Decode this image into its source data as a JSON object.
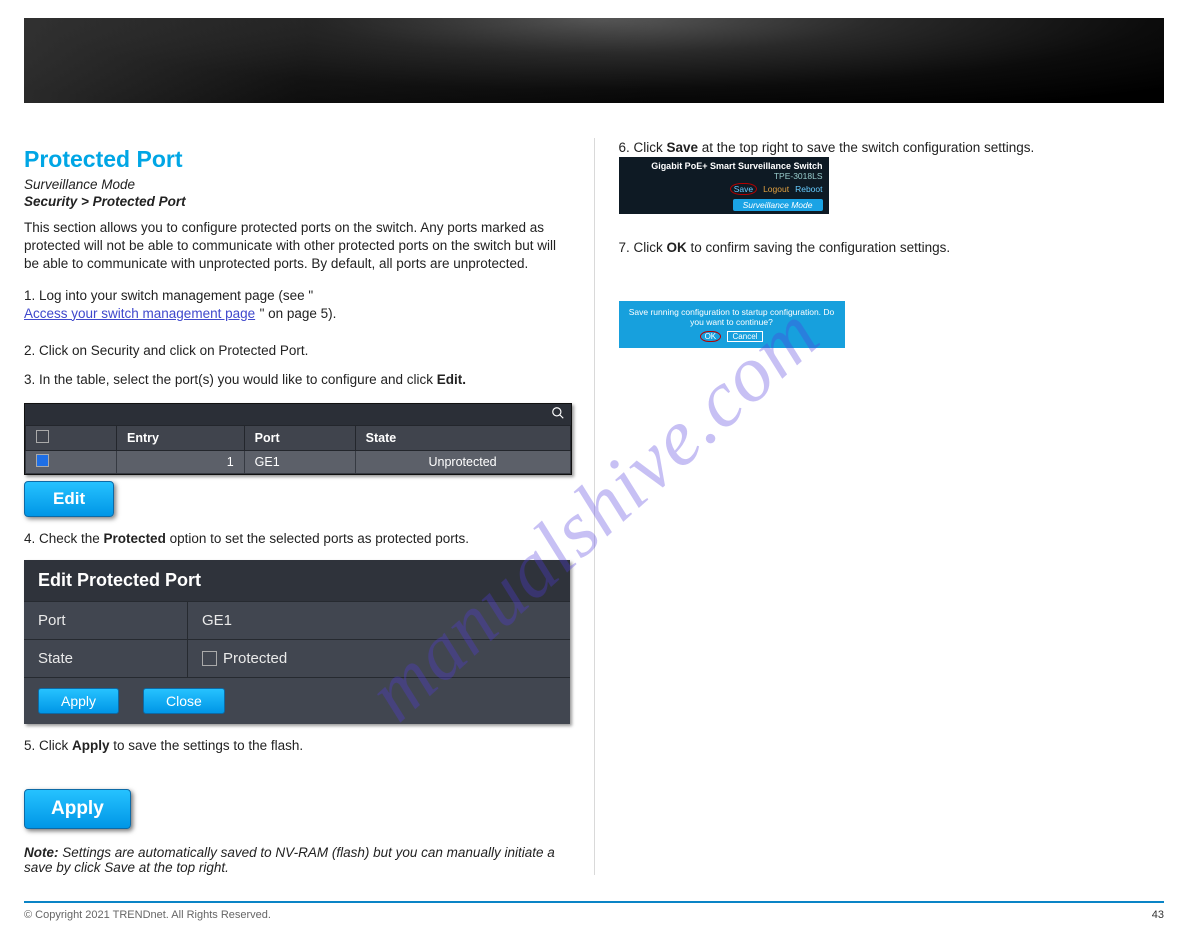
{
  "header": {
    "copyright": "",
    "guide": "",
    "model": ""
  },
  "left": {
    "title": "Protected Port",
    "sub": "Surveillance Mode",
    "path": "Security > Protected Port",
    "intro": "This section allows you to configure protected ports on the switch. Any ports marked as protected will not be able to communicate with other protected ports on the switch but will be able to communicate with unprotected ports. By default, all ports are unprotected.",
    "step1_prefix": "1. Log into your switch management page (see \"",
    "step1_link": "Access your switch management page",
    "step1_suffix": "\" on page 5).",
    "step2": "2. Click on Security and click on Protected Port.",
    "step3_a": "3. In the table, select the port(s) you would like to configure and click ",
    "step3_b": "Edit.",
    "table": {
      "cols": [
        "",
        "Entry",
        "Port",
        "State"
      ],
      "row": {
        "entry": "1",
        "port": "GE1",
        "state": "Unprotected"
      },
      "edit": "Edit"
    },
    "step4_a": "4. Check the ",
    "step4_b": "Protected",
    "step4_c": " option to set the selected ports as protected ports.",
    "panel": {
      "title": "Edit Protected Port",
      "port_label": "Port",
      "port_value": "GE1",
      "state_label": "State",
      "state_value": "Protected",
      "apply": "Apply",
      "close": "Close"
    },
    "step5_a": "5. Click ",
    "step5_b": "Apply",
    "step5_c": " to save the settings to the flash.",
    "apply_btn": "Apply",
    "note_a": "Note: ",
    "note_b": "Settings are automatically saved to NV-RAM (flash) but you can manually initiate a save by click Save at the top right."
  },
  "right": {
    "step6_a": "6. Click ",
    "step6_b": "Save",
    "step6_c": " at the top right to save the switch configuration settings.",
    "mini": {
      "t1": "Gigabit PoE+ Smart Surveillance Switch",
      "t2": "TPE-3018LS",
      "save": "Save",
      "logout": "Logout",
      "reboot": "Reboot",
      "mode": "Surveillance Mode"
    },
    "step7_a": "7. Click ",
    "step7_b": "OK",
    "step7_c": " to confirm saving the configuration settings.",
    "dialog": {
      "msg": "Save running configuration to startup configuration. Do you want to continue?",
      "ok": "OK",
      "cancel": "Cancel"
    }
  },
  "footer": {
    "left": "© Copyright 2021 TRENDnet. All Rights Reserved.",
    "right": "43"
  },
  "watermark": "manualshive.com"
}
